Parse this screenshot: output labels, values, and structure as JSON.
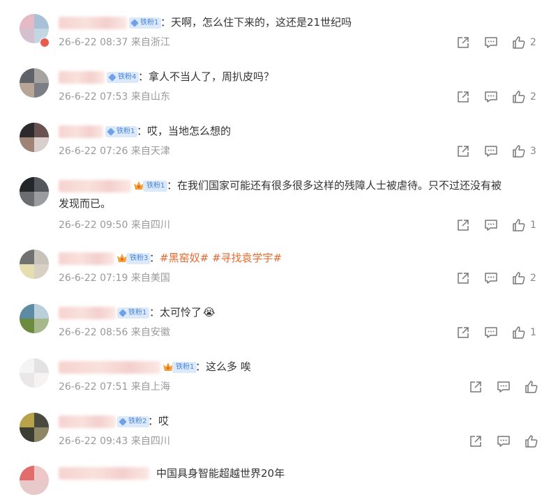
{
  "comments": [
    {
      "badge": "铁粉1",
      "text": "：天啊，怎么住下来的，这还是21世纪吗",
      "meta": "26-6-22 08:37 来自浙江",
      "likes": "2"
    },
    {
      "badge": "铁粉4",
      "text": "：拿人不当人了，周扒皮吗？",
      "meta": "26-6-22 07:53 来自山东",
      "likes": "2"
    },
    {
      "badge": "铁粉1",
      "text": "：哎，当地怎么想的",
      "meta": "26-6-22 07:26 来自天津",
      "likes": "3"
    },
    {
      "badge": "铁粉1",
      "text_line1": "：在我们国家可能还有很多很多这样的残障人士被虐待。只不过还没有被",
      "text_line2": "发现而已。",
      "meta": "26-6-22 09:50 来自四川",
      "likes": "1"
    },
    {
      "badge": "铁粉3",
      "text_prefix": "：",
      "tags": [
        "#黑窑奴#",
        "#寻找袁学宇#"
      ],
      "meta": "26-6-22 07:19 来自美国",
      "likes": "2"
    },
    {
      "badge": "铁粉1",
      "text": "：太可怜了",
      "emoji": "😭",
      "meta": "26-6-22 08:56 来自安徽",
      "likes": "1"
    },
    {
      "badge": "铁粉1",
      "text": "：这么多 唉",
      "meta": "26-6-22 07:51 来自上海",
      "likes": ""
    },
    {
      "badge": "铁粉2",
      "text": "：哎",
      "meta": "26-6-22 09:43 来自四川",
      "likes": ""
    },
    {
      "text": "中国具身智能超越世界20年"
    }
  ],
  "icons": {
    "share": "share-icon",
    "comment": "comment-icon",
    "like": "like-icon"
  },
  "colors": {
    "meta": "#999999",
    "tag": "#e8692e",
    "badge_bg": "#dbe9fb",
    "badge_text": "#4a86d8"
  }
}
